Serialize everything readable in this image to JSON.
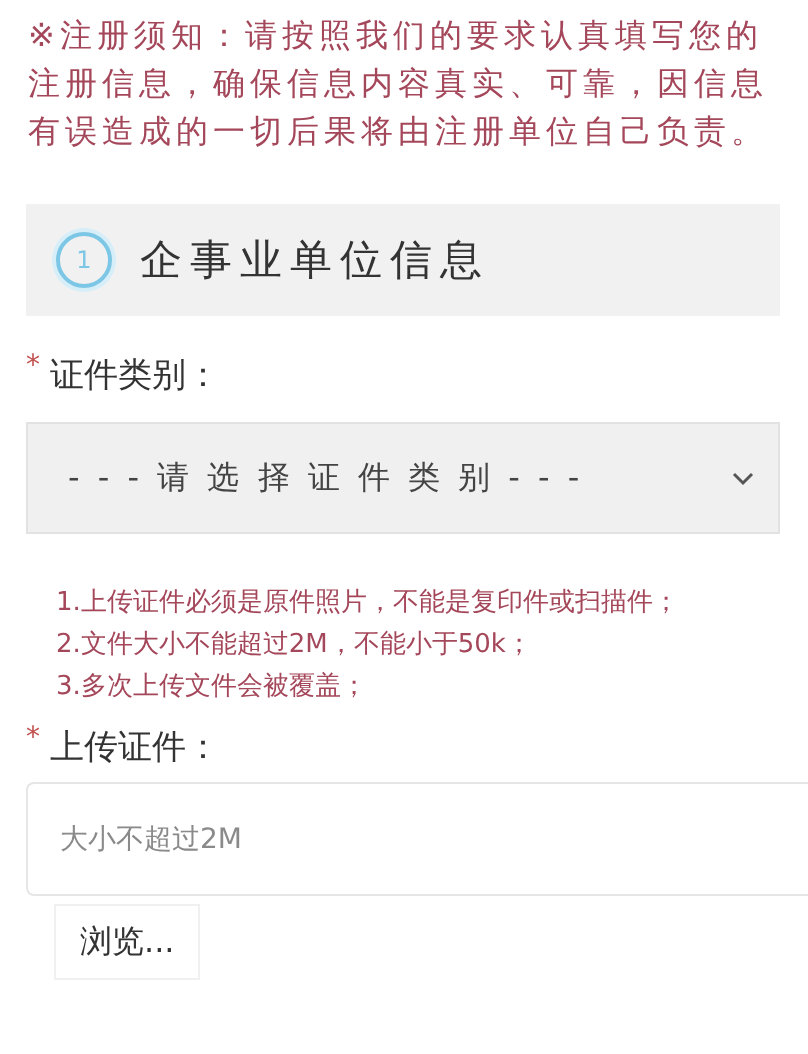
{
  "notice": "※注册须知：请按照我们的要求认真填写您的注册信息，确保信息内容真实、可靠，因信息有误造成的一切后果将由注册单位自己负责。",
  "section": {
    "step": "1",
    "title": "企事业单位信息"
  },
  "cert_type": {
    "required_mark": "*",
    "label": "证件类别：",
    "select_value": "- - - 请 选 择 证 件 类 别 - - -"
  },
  "rules": [
    "1.上传证件必须是原件照片，不能是复印件或扫描件；",
    "2.文件大小不能超过2M，不能小于50k；",
    "3.多次上传文件会被覆盖；"
  ],
  "upload": {
    "required_mark": "*",
    "label": "上传证件：",
    "placeholder": "大小不超过2M",
    "button": "浏览..."
  }
}
